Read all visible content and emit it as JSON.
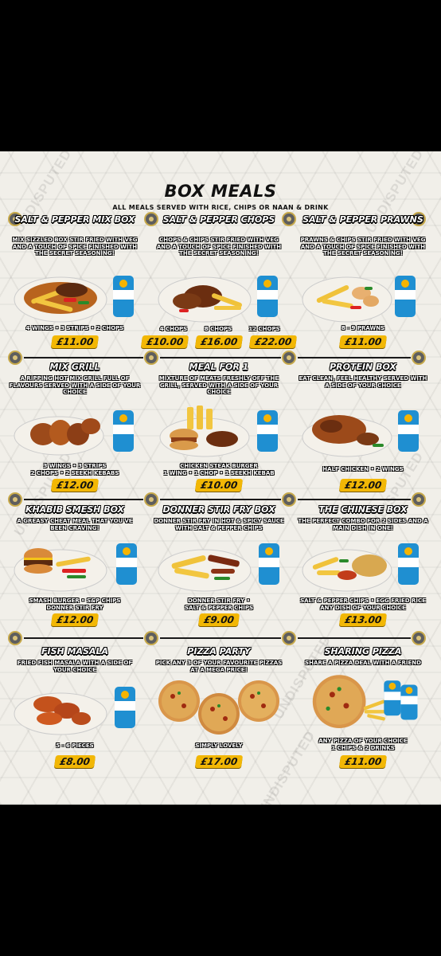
{
  "header": {
    "title": "BOX MEALS",
    "subtitle": "ALL MEALS SERVED WITH RICE, CHIPS OR NAAN & DRINK"
  },
  "watermark": "UNDISPUTED",
  "drink_label": "Rubicon",
  "colors": {
    "price_bg": "#f2b705",
    "background": "#f1efe9",
    "frame": "#000000"
  },
  "items": [
    {
      "name": "SALT & PEPPER MIX BOX",
      "desc": "MIX SIZZLED BOX STIR FRIED WITH VEG AND A TOUCH OF SPICE FINISHED WITH THE SECRET SEASONING!",
      "portions": "4 WINGS • 3 STRIPS • 2 CHOPS",
      "prices": [
        "£11.00"
      ]
    },
    {
      "name": "SALT & PEPPER CHOPS",
      "desc": "CHOPS & CHIPS STIR FRIED WITH VEG AND A TOUCH OF SPICE FINISHED WITH THE SECRET SEASONING!",
      "options": [
        "4 CHOPS",
        "8 CHOPS",
        "12 CHOPS"
      ],
      "prices": [
        "£10.00",
        "£16.00",
        "£22.00"
      ]
    },
    {
      "name": "SALT & PEPPER PRAWNS",
      "desc": "PRAWNS & CHIPS STIR FRIED WITH VEG AND A TOUCH OF SPICE FINISHED WITH THE SECRET SEASONING!",
      "portions": "8 - 9 PRAWNS",
      "prices": [
        "£11.00"
      ]
    },
    {
      "name": "MIX GRILL",
      "desc": "A RIPPING HOT MIX GRILL FULL OF FLAVOURS SERVED WITH A SIDE OF YOUR CHOICE",
      "portions": "3 WINGS • 3 STRIPS\n2 CHOPS • 2 SEEKH KEBABS",
      "prices": [
        "£12.00"
      ]
    },
    {
      "name": "MEAL FOR 1",
      "desc": "MIXTURE OF MEATS FRESHLY OFF THE GRILL, SERVED WITH A SIDE OF YOUR CHOICE",
      "portions": "CHICKEN STEAK BURGER\n1 WING • 1 CHOP • 1 SEEKH KEBAB",
      "prices": [
        "£10.00"
      ]
    },
    {
      "name": "PROTEIN BOX",
      "desc": "EAT CLEAN, FEEL HEALTHY SERVED WITH A SIDE OF YOUR CHOICE",
      "portions": "HALF CHICKEN • 2 WINGS",
      "prices": [
        "£12.00"
      ]
    },
    {
      "name": "KHABIB SMESH BOX",
      "desc": "A GREASY CHEAT MEAL THAT YOU'VE BEEN CRAVING!",
      "portions": "SMASH BURGER • S&P CHIPS\nDONNER STIR FRY",
      "prices": [
        "£12.00"
      ]
    },
    {
      "name": "DONNER STIR FRY BOX",
      "desc": "DONNER STIR FRY IN HOT & SPICY SAUCE WITH SALT & PEPPER CHIPS",
      "portions": "DONNER STIR FRY •\nSALT & PEPPER CHIPS",
      "prices": [
        "£9.00"
      ]
    },
    {
      "name": "THE CHINESE BOX",
      "desc": "THE PERFECT COMBO FOR 2 SIDES AND A MAIN DISH IN ONE!",
      "portions": "SALT & PEPPER CHIPS • EGG FRIED RICE\nANY DISH OF YOUR CHOICE",
      "prices": [
        "£13.00"
      ]
    },
    {
      "name": "FISH MASALA",
      "desc": "FRIED FISH MASALA WITH A SIDE OF YOUR CHOICE",
      "portions": "5 - 6 PIECES",
      "prices": [
        "£8.00"
      ]
    },
    {
      "name": "PIZZA PARTY",
      "desc": "PICK ANY 3 OF YOUR FAVOURITE PIZZAS AT A MEGA PRICE!",
      "portions": "SIMPLY LOVELY",
      "prices": [
        "£17.00"
      ]
    },
    {
      "name": "SHARING PIZZA",
      "desc": "SHARE A PIZZA DEAL WITH A FRIEND",
      "portions": "ANY PIZZA OF YOUR CHOICE\n1 CHIPS & 2 DRINKS",
      "prices": [
        "£11.00"
      ]
    }
  ]
}
